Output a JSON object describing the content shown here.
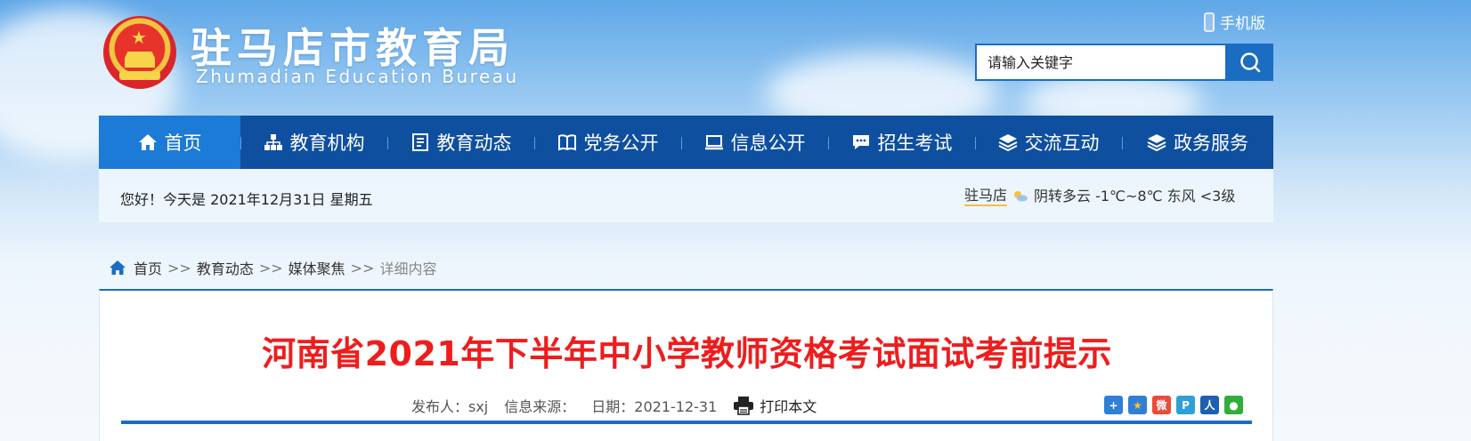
{
  "header": {
    "site_title": "驻马店市教育局",
    "site_subtitle": "Zhumadian Education Bureau",
    "mobile_label": "手机版",
    "search": {
      "placeholder": "请输入关键字"
    }
  },
  "nav": {
    "items": [
      {
        "label": "首页",
        "icon": "home-icon",
        "active": true
      },
      {
        "label": "教育机构",
        "icon": "org-chart-icon"
      },
      {
        "label": "教育动态",
        "icon": "document-icon"
      },
      {
        "label": "党务公开",
        "icon": "book-icon"
      },
      {
        "label": "信息公开",
        "icon": "laptop-icon"
      },
      {
        "label": "招生考试",
        "icon": "chat-icon"
      },
      {
        "label": "交流互动",
        "icon": "layers-icon"
      },
      {
        "label": "政务服务",
        "icon": "layers-icon"
      }
    ]
  },
  "greeting": {
    "text": "您好！今天是 2021年12月31日 星期五",
    "weather_city": "驻马店",
    "weather_desc": "阴转多云 -1℃~8℃ 东风 <3级"
  },
  "breadcrumb": {
    "home": "首页",
    "sep": ">>",
    "level1": "教育动态",
    "level2": "媒体聚焦",
    "current": "详细内容"
  },
  "article": {
    "title": "河南省2021年下半年中小学教师资格考试面试考前提示",
    "publisher_label": "发布人：sxj",
    "source_label": "信息来源：",
    "date_label": "日期：2021-12-31",
    "print_label": "打印本文"
  },
  "colors": {
    "nav_bg": "#0f4f9f",
    "nav_active": "#1c7bd6",
    "title_red": "#ee1d1d",
    "accent_blue": "#1b6dc1"
  }
}
